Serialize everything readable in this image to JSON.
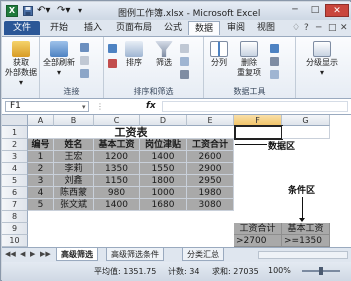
{
  "window": {
    "title": "图例工作簿.xlsx  -  Microsoft Excel",
    "app_icon": "X",
    "undo_glyph": "↶▾",
    "redo_glyph": "↷▾",
    "customize_glyph": "▾",
    "min_glyph": "─",
    "max_glyph": "□",
    "close_glyph": "✕",
    "help_glyphs": [
      "♢",
      "?",
      "─",
      "□",
      "✕"
    ]
  },
  "ribbon_tabs": [
    {
      "label": "文件"
    },
    {
      "label": "开始"
    },
    {
      "label": "插入"
    },
    {
      "label": "页面布局"
    },
    {
      "label": "公式"
    },
    {
      "label": "数据"
    },
    {
      "label": "审阅"
    },
    {
      "label": "视图"
    }
  ],
  "active_tab": "数据",
  "ribbon": {
    "groups": [
      {
        "label": "",
        "buttons": [
          {
            "label": "获取\n外部数据▾"
          }
        ]
      },
      {
        "label": "连接",
        "buttons": [
          {
            "label": "全部刷新\n▾"
          }
        ]
      },
      {
        "label": "排序和筛选",
        "buttons": [
          {
            "label": "排序"
          },
          {
            "label": "筛选"
          }
        ]
      },
      {
        "label": "数据工具",
        "buttons": [
          {
            "label": "分列"
          },
          {
            "label": "删除\n重复项"
          }
        ]
      },
      {
        "label": "",
        "buttons": [
          {
            "label": "分级显示\n▾"
          }
        ]
      }
    ]
  },
  "formula_bar": {
    "name_box": "F1",
    "fx_label": "fx",
    "formula": ""
  },
  "columns": [
    "A",
    "B",
    "C",
    "D",
    "E",
    "F",
    "G"
  ],
  "rows": [
    "1",
    "2",
    "3",
    "4",
    "5",
    "6",
    "7",
    "8",
    "9",
    "10"
  ],
  "sheet": {
    "title": "工资表",
    "headers": [
      "编号",
      "姓名",
      "基本工资",
      "岗位津贴",
      "工资合计"
    ],
    "data": [
      [
        "1",
        "王宏",
        "1200",
        "1400",
        "2600"
      ],
      [
        "2",
        "李莉",
        "1350",
        "1550",
        "2900"
      ],
      [
        "3",
        "刘鑫",
        "1150",
        "1800",
        "2950"
      ],
      [
        "4",
        "陈西蒙",
        "980",
        "1000",
        "1980"
      ],
      [
        "5",
        "张文斌",
        "1400",
        "1680",
        "3080"
      ]
    ],
    "criteria_headers": [
      "工资合计",
      "基本工资"
    ],
    "criteria_values": [
      ">2700",
      ">=1350"
    ]
  },
  "annotations": {
    "data_area": "数据区",
    "criteria_area": "条件区"
  },
  "sheet_tabs": [
    {
      "label": "高级筛选"
    },
    {
      "label": "高级筛选条件"
    },
    {
      "label": "分类汇总"
    }
  ],
  "active_sheet": "高级筛选",
  "nav_glyphs": [
    "◀◀",
    "◀",
    "▶",
    "▶▶"
  ],
  "status": {
    "average": "平均值: 1351.75",
    "count": "计数: 34",
    "sum": "求和: 27035",
    "zoom": "100%"
  },
  "colors": {
    "file_tab": "#2b5797",
    "data_shade": "#a9a9a9",
    "close_button": "#c9463d"
  }
}
